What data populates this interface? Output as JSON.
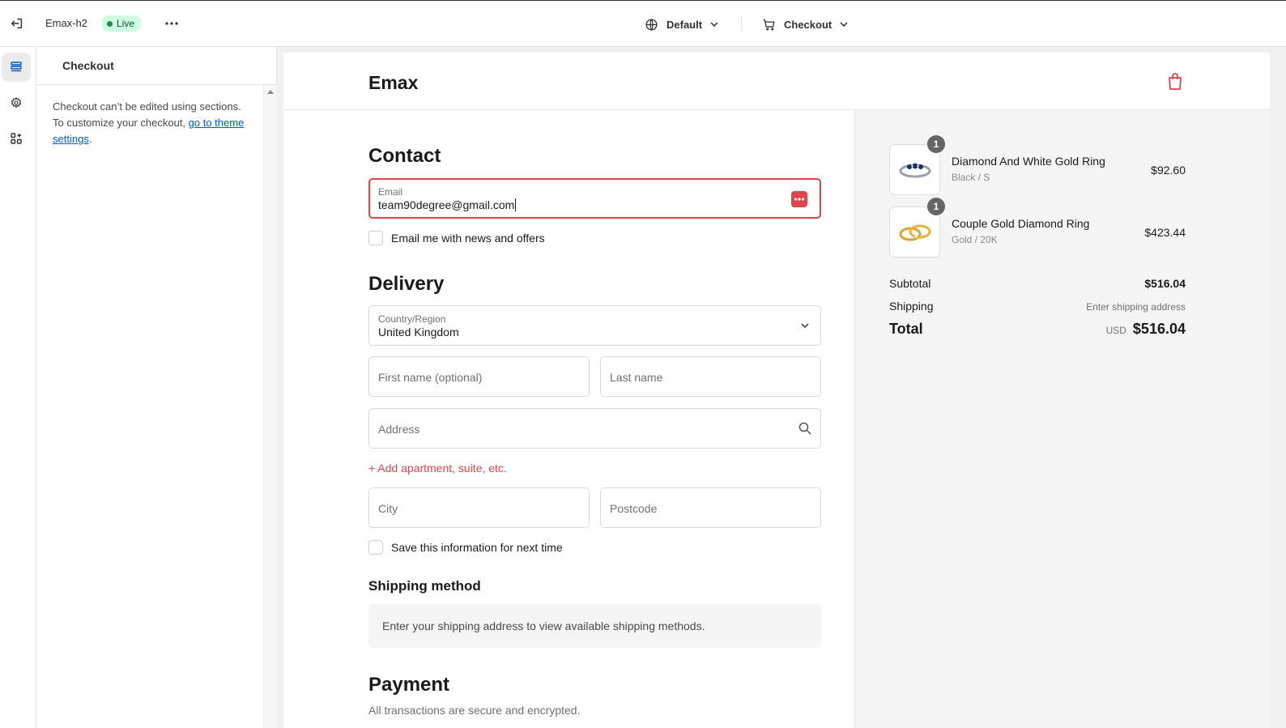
{
  "topbar": {
    "store_name": "Emax-h2",
    "status_badge": "Live",
    "language_selector": "Default",
    "page_selector": "Checkout"
  },
  "sidebar_panel": {
    "title": "Checkout",
    "message": "Checkout can’t be edited using sections. To customize your checkout,",
    "link_text": "go to theme settings",
    "trailing": "."
  },
  "preview": {
    "brand": "Emax",
    "contact": {
      "title": "Contact",
      "email_label": "Email",
      "email_value": "team90degree@gmail.com",
      "newsletter_label": "Email me with news and offers"
    },
    "delivery": {
      "title": "Delivery",
      "country_label": "Country/Region",
      "country_value": "United Kingdom",
      "first_name_placeholder": "First name (optional)",
      "last_name_placeholder": "Last name",
      "address_placeholder": "Address",
      "add_apartment": "+ Add apartment, suite, etc.",
      "city_placeholder": "City",
      "postcode_placeholder": "Postcode",
      "save_info_label": "Save this information for next time"
    },
    "shipping_method": {
      "title": "Shipping method",
      "message": "Enter your shipping address to view available shipping methods."
    },
    "payment": {
      "title": "Payment",
      "subtitle": "All transactions are secure and encrypted."
    },
    "order_summary": {
      "items": [
        {
          "name": "Diamond And White Gold Ring",
          "variant": "Black / S",
          "price": "$92.60",
          "quantity": "1"
        },
        {
          "name": "Couple Gold Diamond Ring",
          "variant": "Gold / 20K",
          "price": "$423.44",
          "quantity": "1"
        }
      ],
      "subtotal_label": "Subtotal",
      "subtotal_value": "$516.04",
      "shipping_label": "Shipping",
      "shipping_value": "Enter shipping address",
      "total_label": "Total",
      "total_currency": "USD",
      "total_value": "$516.04"
    }
  },
  "colors": {
    "accent": "#e0444b",
    "live_badge_bg": "#cdfee1",
    "link": "#005bd3"
  }
}
